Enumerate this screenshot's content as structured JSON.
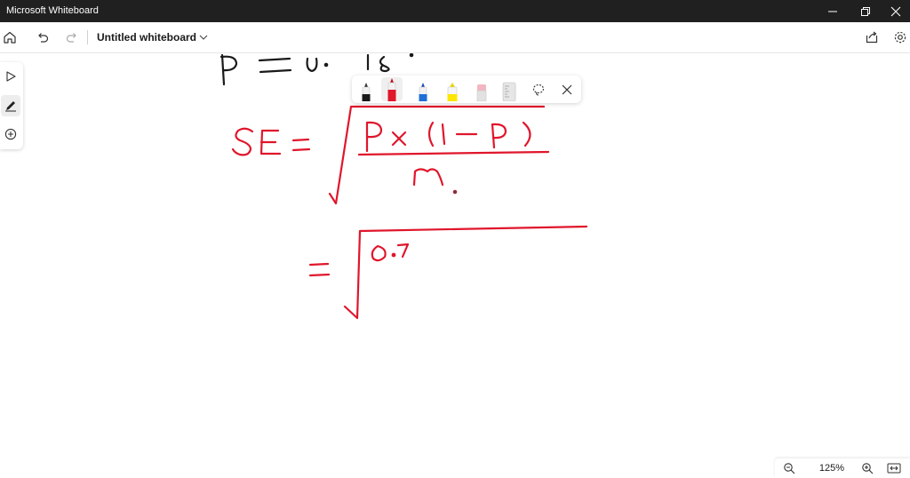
{
  "window": {
    "title": "Microsoft Whiteboard"
  },
  "toolbar": {
    "doc_title": "Untitled whiteboard"
  },
  "zoom": {
    "level": "125%"
  },
  "icons": {
    "window": [
      "minimize-icon",
      "restore-icon",
      "close-icon"
    ],
    "toolbar": [
      "home-icon",
      "undo-icon",
      "redo-icon",
      "chevron-down-icon",
      "share-icon",
      "settings-icon"
    ],
    "side_rail": [
      "select-arrow-icon",
      "pen-icon",
      "add-icon"
    ],
    "pen_tray": [
      "black-pen-icon",
      "red-pen-icon",
      "blue-pen-icon",
      "yellow-highlighter-icon",
      "eraser-icon",
      "ruler-icon",
      "lasso-icon",
      "close-icon"
    ],
    "zoom_bar": [
      "zoom-out-icon",
      "zoom-in-icon",
      "fit-to-screen-icon"
    ]
  },
  "colors": {
    "titlebar": "#202020",
    "ink": "#e0162b",
    "black_ink": "#1a1a1a"
  }
}
